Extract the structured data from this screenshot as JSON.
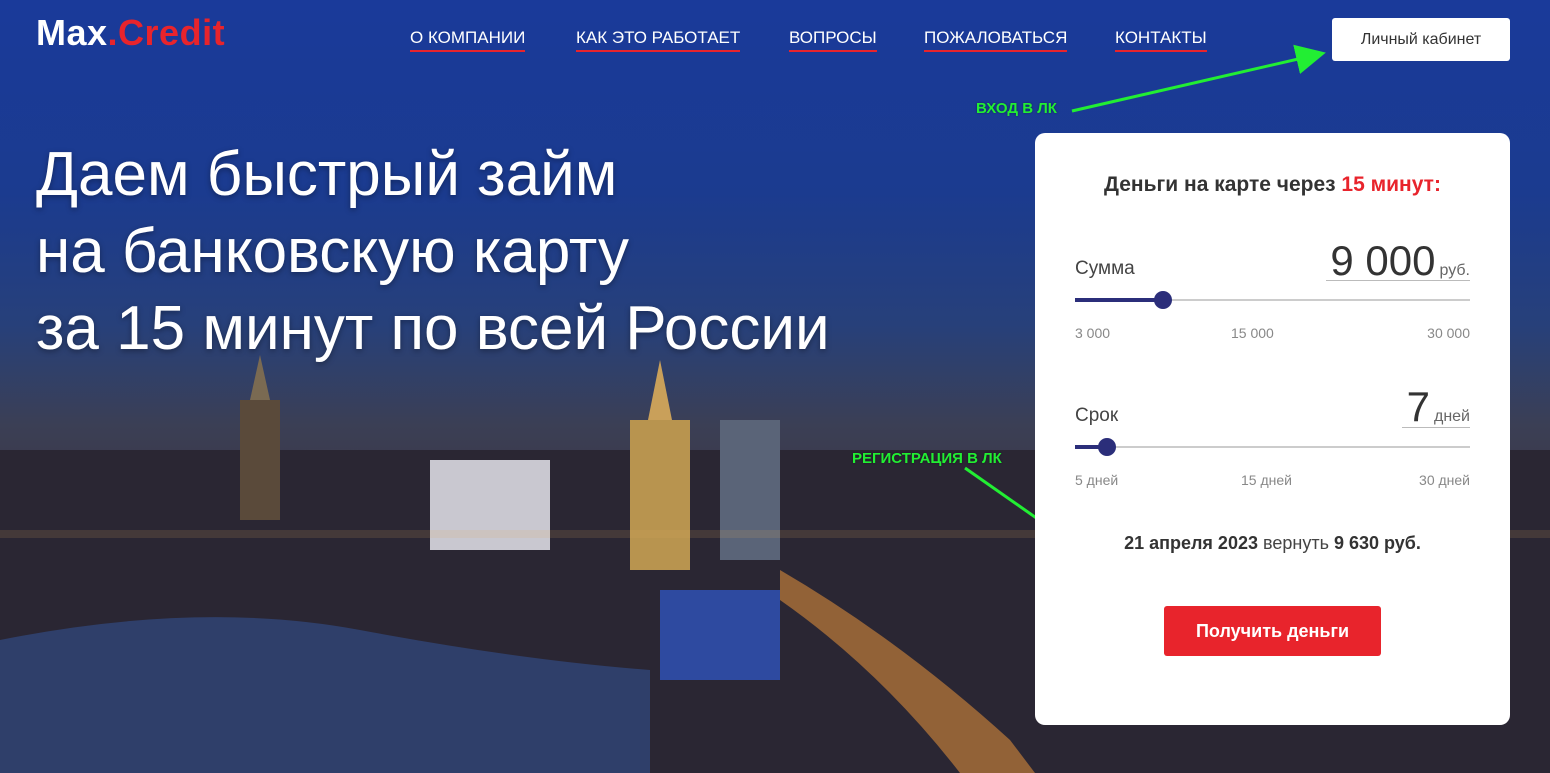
{
  "header": {
    "logo_main": "Max",
    "logo_dot": ".",
    "logo_accent": "Credit",
    "nav": [
      {
        "label": "О КОМПАНИИ"
      },
      {
        "label": "КАК ЭТО РАБОТАЕТ"
      },
      {
        "label": "ВОПРОСЫ"
      },
      {
        "label": "ПОЖАЛОВАТЬСЯ"
      },
      {
        "label": "КОНТАКТЫ"
      }
    ],
    "cabinet_button": "Личный кабинет"
  },
  "hero": {
    "lines": [
      "Даем быстрый займ",
      "на банковскую карту",
      "за 15 минут по всей России"
    ]
  },
  "annotations": {
    "login": "ВХОД В ЛК",
    "registration": "РЕГИСТРАЦИЯ В ЛК"
  },
  "calculator": {
    "title_prefix": "Деньги на карте через",
    "title_highlight": "15 минут:",
    "amount": {
      "label": "Сумма",
      "value": "9 000",
      "unit": "руб.",
      "min_label": "3 000",
      "mid_label": "15 000",
      "max_label": "30 000",
      "min": 3000,
      "max": 30000,
      "current": 9000
    },
    "term": {
      "label": "Срок",
      "value": "7",
      "unit": "дней",
      "min_label": "5 дней",
      "mid_label": "15 дней",
      "max_label": "30 дней",
      "min": 5,
      "max": 30,
      "current": 7
    },
    "summary_date": "21 апреля 2023",
    "summary_mid": "вернуть",
    "summary_amount": "9 630 руб.",
    "submit_button": "Получить деньги"
  },
  "colors": {
    "accent": "#e8242c",
    "slider": "#2b2e7a",
    "annotation": "#22ee33"
  }
}
